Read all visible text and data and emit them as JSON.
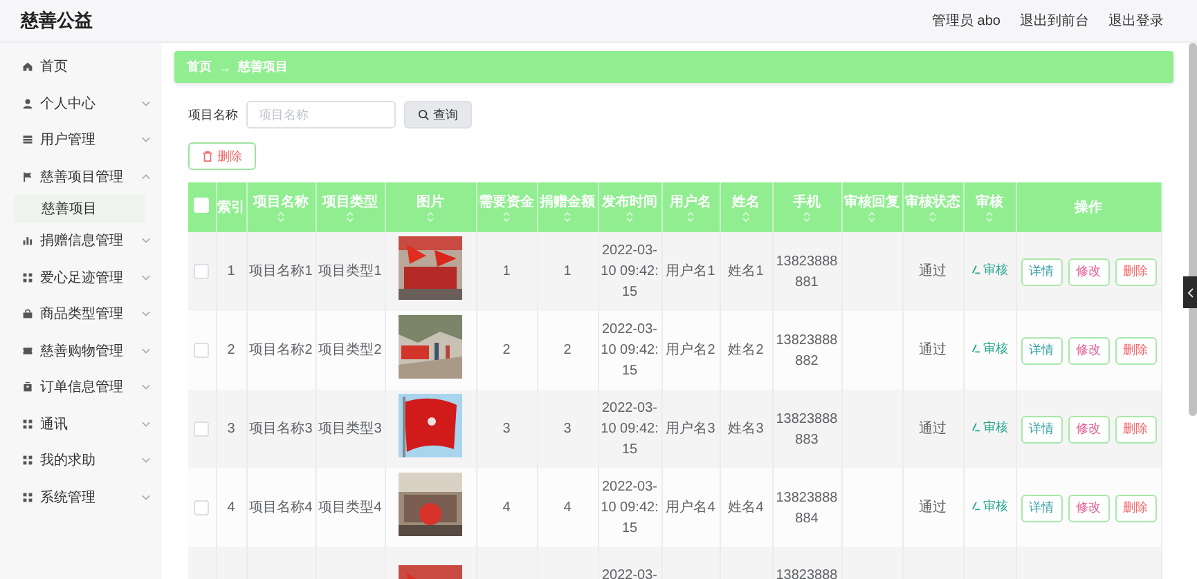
{
  "header": {
    "title": "慈善公益",
    "links": [
      "管理员 abo",
      "退出到前台",
      "退出登录"
    ]
  },
  "sidebar": {
    "items": [
      {
        "label": "首页"
      },
      {
        "label": "个人中心",
        "expanded": false
      },
      {
        "label": "用户管理",
        "expanded": false
      },
      {
        "label": "慈善项目管理",
        "expanded": true,
        "children": [
          {
            "label": "慈善项目",
            "selected": true
          }
        ]
      },
      {
        "label": "捐赠信息管理",
        "expanded": false
      },
      {
        "label": "爱心足迹管理",
        "expanded": false
      },
      {
        "label": "商品类型管理",
        "expanded": false
      },
      {
        "label": "慈善购物管理",
        "expanded": false
      },
      {
        "label": "订单信息管理",
        "expanded": false
      },
      {
        "label": "通讯",
        "expanded": false
      },
      {
        "label": "我的求助",
        "expanded": false
      },
      {
        "label": "系统管理",
        "expanded": false
      }
    ]
  },
  "breadcrumb": [
    "首页",
    "→",
    "慈善项目"
  ],
  "search": {
    "label": "项目名称",
    "placeholder": "项目名称",
    "button": "查询"
  },
  "delete_button": "删除",
  "table": {
    "select_all_checked": false,
    "columns": [
      {
        "label": "索引",
        "sortable": false
      },
      {
        "label": "项目名称",
        "sortable": true
      },
      {
        "label": "项目类型",
        "sortable": true
      },
      {
        "label": "图片",
        "sortable": true
      },
      {
        "label": "需要资金",
        "sortable": true
      },
      {
        "label": "捐赠金额",
        "sortable": true
      },
      {
        "label": "发布时间",
        "sortable": true
      },
      {
        "label": "用户名",
        "sortable": true
      },
      {
        "label": "姓名",
        "sortable": true
      },
      {
        "label": "手机",
        "sortable": true
      },
      {
        "label": "审核回复",
        "sortable": true
      },
      {
        "label": "审核状态",
        "sortable": true
      },
      {
        "label": "审核",
        "sortable": true
      },
      {
        "label": "操作",
        "sortable": false
      }
    ],
    "rows": [
      {
        "checked": false,
        "index": "1",
        "name": "项目名称1",
        "type": "项目类型1",
        "need": "1",
        "donated": "1",
        "date": "2022-03-10 09:42:15",
        "username": "用户名1",
        "realname": "姓名1",
        "phone": "13823888881",
        "status": "通过",
        "review": "审核",
        "actions": [
          "详情",
          "修改",
          "删除"
        ]
      },
      {
        "checked": false,
        "index": "2",
        "name": "项目名称2",
        "type": "项目类型2",
        "need": "2",
        "donated": "2",
        "date": "2022-03-10 09:42:15",
        "username": "用户名2",
        "realname": "姓名2",
        "phone": "13823888882",
        "status": "通过",
        "review": "审核",
        "actions": [
          "详情",
          "修改",
          "删除"
        ]
      },
      {
        "checked": false,
        "index": "3",
        "name": "项目名称3",
        "type": "项目类型3",
        "need": "3",
        "donated": "3",
        "date": "2022-03-10 09:42:15",
        "username": "用户名3",
        "realname": "姓名3",
        "phone": "13823888883",
        "status": "通过",
        "review": "审核",
        "actions": [
          "详情",
          "修改",
          "删除"
        ]
      },
      {
        "checked": false,
        "index": "4",
        "name": "项目名称4",
        "type": "项目类型4",
        "need": "4",
        "donated": "4",
        "date": "2022-03-10 09:42:15",
        "username": "用户名4",
        "realname": "姓名4",
        "phone": "13823888884",
        "status": "通过",
        "review": "审核",
        "actions": [
          "详情",
          "修改",
          "删除"
        ]
      },
      {
        "date": "2022-03-",
        "phone": "13823888"
      }
    ]
  }
}
